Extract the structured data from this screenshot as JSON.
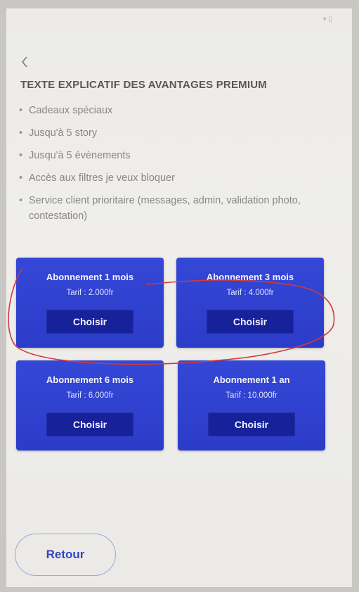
{
  "status_bar": {
    "left_text": "",
    "right_text": "▾ ▯"
  },
  "nav": {
    "back_icon": "chevron-left-icon"
  },
  "title": "TEXTE EXPLICATIF DES AVANTAGES PREMIUM",
  "benefits": [
    "Cadeaux spéciaux",
    "Jusqu'à 5 story",
    "Jusqu'à 5 évènements",
    "Accès aux filtres je veux bloquer",
    "Service client prioritaire (messages, admin, validation photo, contestation)"
  ],
  "plans": [
    {
      "name": "Abonnement 1 mois",
      "price": "Tarif : 2.000fr",
      "button": "Choisir"
    },
    {
      "name": "Abonnement 3 mois",
      "price": "Tarif : 4.000fr",
      "button": "Choisir"
    },
    {
      "name": "Abonnement 6 mois",
      "price": "Tarif : 6.000fr",
      "button": "Choisir"
    },
    {
      "name": "Abonnement 1 an",
      "price": "Tarif : 10.000fr",
      "button": "Choisir"
    }
  ],
  "footer": {
    "back_button": "Retour"
  },
  "colors": {
    "card_blue": "#2f41cf",
    "button_navy": "#17219a",
    "annotation_red": "#d23a3a",
    "accent_blue": "#3444c7"
  }
}
